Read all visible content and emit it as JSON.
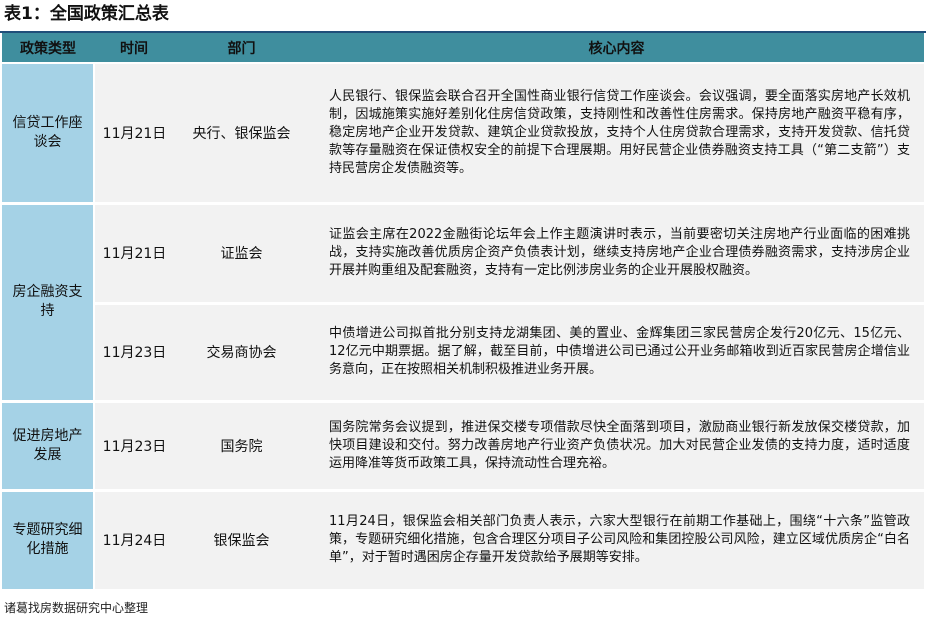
{
  "title": "表1：全国政策汇总表",
  "headers": {
    "type": "政策类型",
    "time": "时间",
    "dept": "部门",
    "content": "核心内容"
  },
  "rows": [
    {
      "type": "信贷工作座谈会",
      "date": "11月21日",
      "dept": "央行、银保监会",
      "content": "人民银行、银保监会联合召开全国性商业银行信贷工作座谈会。会议强调，要全面落实房地产长效机制，因城施策实施好差别化住房信贷政策，支持刚性和改善性住房需求。保持房地产融资平稳有序，稳定房地产企业开发贷款、建筑企业贷款投放，支持个人住房贷款合理需求，支持开发贷款、信托贷款等存量融资在保证债权安全的前提下合理展期。用好民营企业债券融资支持工具（“第二支箭”）支持民营房企发债融资等。"
    },
    {
      "type": "房企融资支持",
      "date": "11月21日",
      "dept": "证监会",
      "content": "证监会主席在2022金融街论坛年会上作主题演讲时表示，当前要密切关注房地产行业面临的困难挑战，支持实施改善优质房企资产负债表计划，继续支持房地产企业合理债券融资需求，支持涉房企业开展并购重组及配套融资，支持有一定比例涉房业务的企业开展股权融资。"
    },
    {
      "date": "11月23日",
      "dept": "交易商协会",
      "content": "中债增进公司拟首批分别支持龙湖集团、美的置业、金辉集团三家民营房企发行20亿元、15亿元、12亿元中期票据。据了解，截至目前，中债增进公司已通过公开业务邮箱收到近百家民营房企增信业务意向，正在按照相关机制积极推进业务开展。"
    },
    {
      "type": "促进房地产发展",
      "date": "11月23日",
      "dept": "国务院",
      "content": "国务院常务会议提到，推进保交楼专项借款尽快全面落到项目，激励商业银行新发放保交楼贷款，加快项目建设和交付。努力改善房地产行业资产负债状况。加大对民营企业发债的支持力度，适时适度运用降准等货币政策工具，保持流动性合理充裕。"
    },
    {
      "type": "专题研究细化措施",
      "date": "11月24日",
      "dept": "银保监会",
      "content": "11月24日，银保监会相关部门负责人表示，六家大型银行在前期工作基础上，围绕“十六条”监管政策，专题研究细化措施，包含合理区分项目子公司风险和集团控股公司风险，建立区域优质房企“白名单”，对于暂时遇困房企存量开发贷款给予展期等安排。"
    }
  ],
  "source": "诸葛找房数据研究中心整理"
}
